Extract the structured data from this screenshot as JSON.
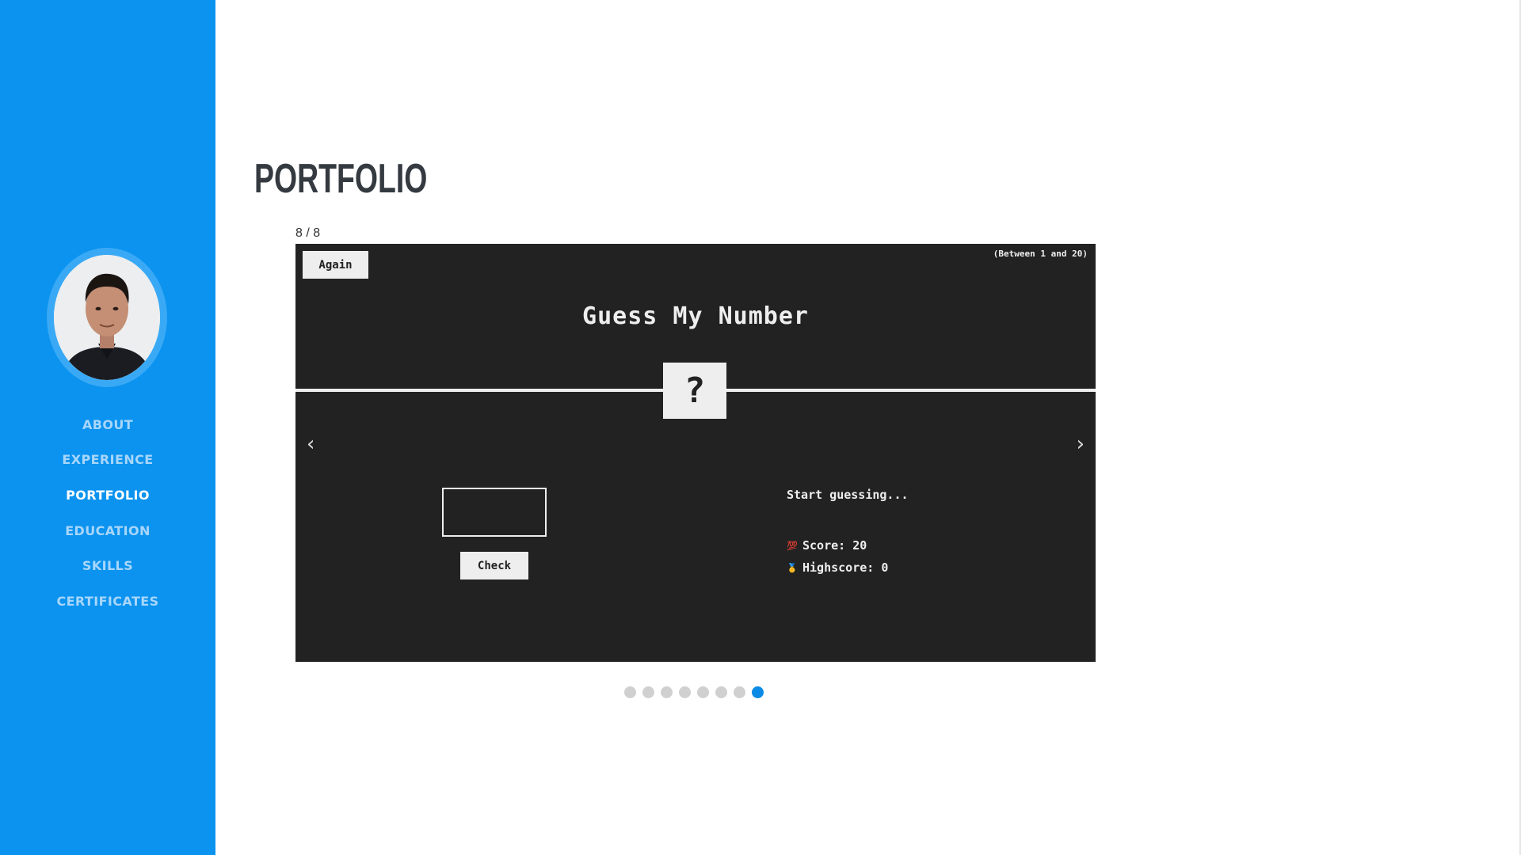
{
  "sidebar": {
    "avatar_alt": "Profile photo",
    "nav": [
      {
        "label": "ABOUT"
      },
      {
        "label": "EXPERIENCE"
      },
      {
        "label": "PORTFOLIO"
      },
      {
        "label": "EDUCATION"
      },
      {
        "label": "SKILLS"
      },
      {
        "label": "CERTIFICATES"
      }
    ],
    "active_item": "PORTFOLIO"
  },
  "main": {
    "title": "PORTFOLIO",
    "carousel": {
      "counter": "8 / 8",
      "prev_arrow": "‹",
      "next_arrow": "›",
      "current_slide": 8,
      "total_slides": 8,
      "slide": {
        "again_label": "Again",
        "range_hint": "(Between 1 and 20)",
        "game_title": "Guess My Number",
        "secret_number": "?",
        "guess_value": "",
        "check_label": "Check",
        "message": "Start guessing...",
        "score_label": "Score: 20",
        "highscore_label": "Highscore: 0",
        "score_icon": "hundred-points-icon",
        "highscore_icon": "medal-icon"
      }
    }
  },
  "colors": {
    "sidebar_bg": "#0b93ef",
    "nav_inactive": "#a8d6fb",
    "nav_active": "#ffffff",
    "slide_bg": "#222222",
    "dot_active": "#0b8ae6",
    "dot_inactive": "#d0d0d0"
  }
}
